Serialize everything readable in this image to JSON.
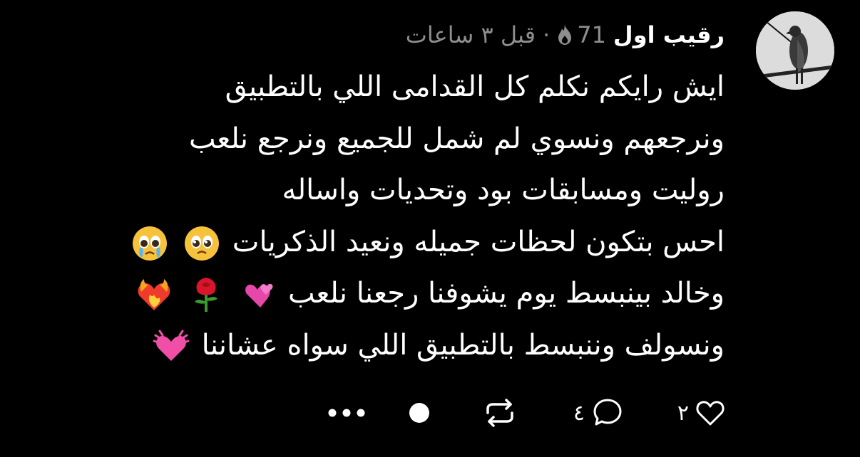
{
  "post": {
    "username": "رقيب اول",
    "rank_label": "71",
    "rank_icon": "fire-icon",
    "time_text": "قبل ٣ ساعات",
    "lines": [
      "ايش رايكم نكلم كل القدامى اللي بالتطبيق",
      "ونرجعهم ونسوي لم شمل للجميع ونرجع نلعب",
      "روليت ومسابقات بود وتحديات واساله",
      "احس بتكون لحظات جميله ونعيد الذكريات",
      "وخالد بينبسط يوم يشوفنا رجعنا نلعب",
      "ونسولف وننبسط بالتطبيق اللي سواه عشاننا"
    ],
    "emojis": {
      "line4": [
        "pleading-face-icon",
        "crying-pleading-face-icon"
      ],
      "line5": [
        "heart-on-fire-icon",
        "rose-icon",
        "revolving-hearts-icon"
      ],
      "line6": [
        "growing-heart-icon"
      ]
    }
  },
  "actions": {
    "like_count": "٢",
    "reply_count": "٤",
    "icons": [
      "heart-icon",
      "comment-icon",
      "repost-icon",
      "record-icon",
      "more-icon"
    ]
  },
  "colors": {
    "background": "#000000",
    "text": "#ffffff",
    "muted": "#8e8e8e"
  }
}
